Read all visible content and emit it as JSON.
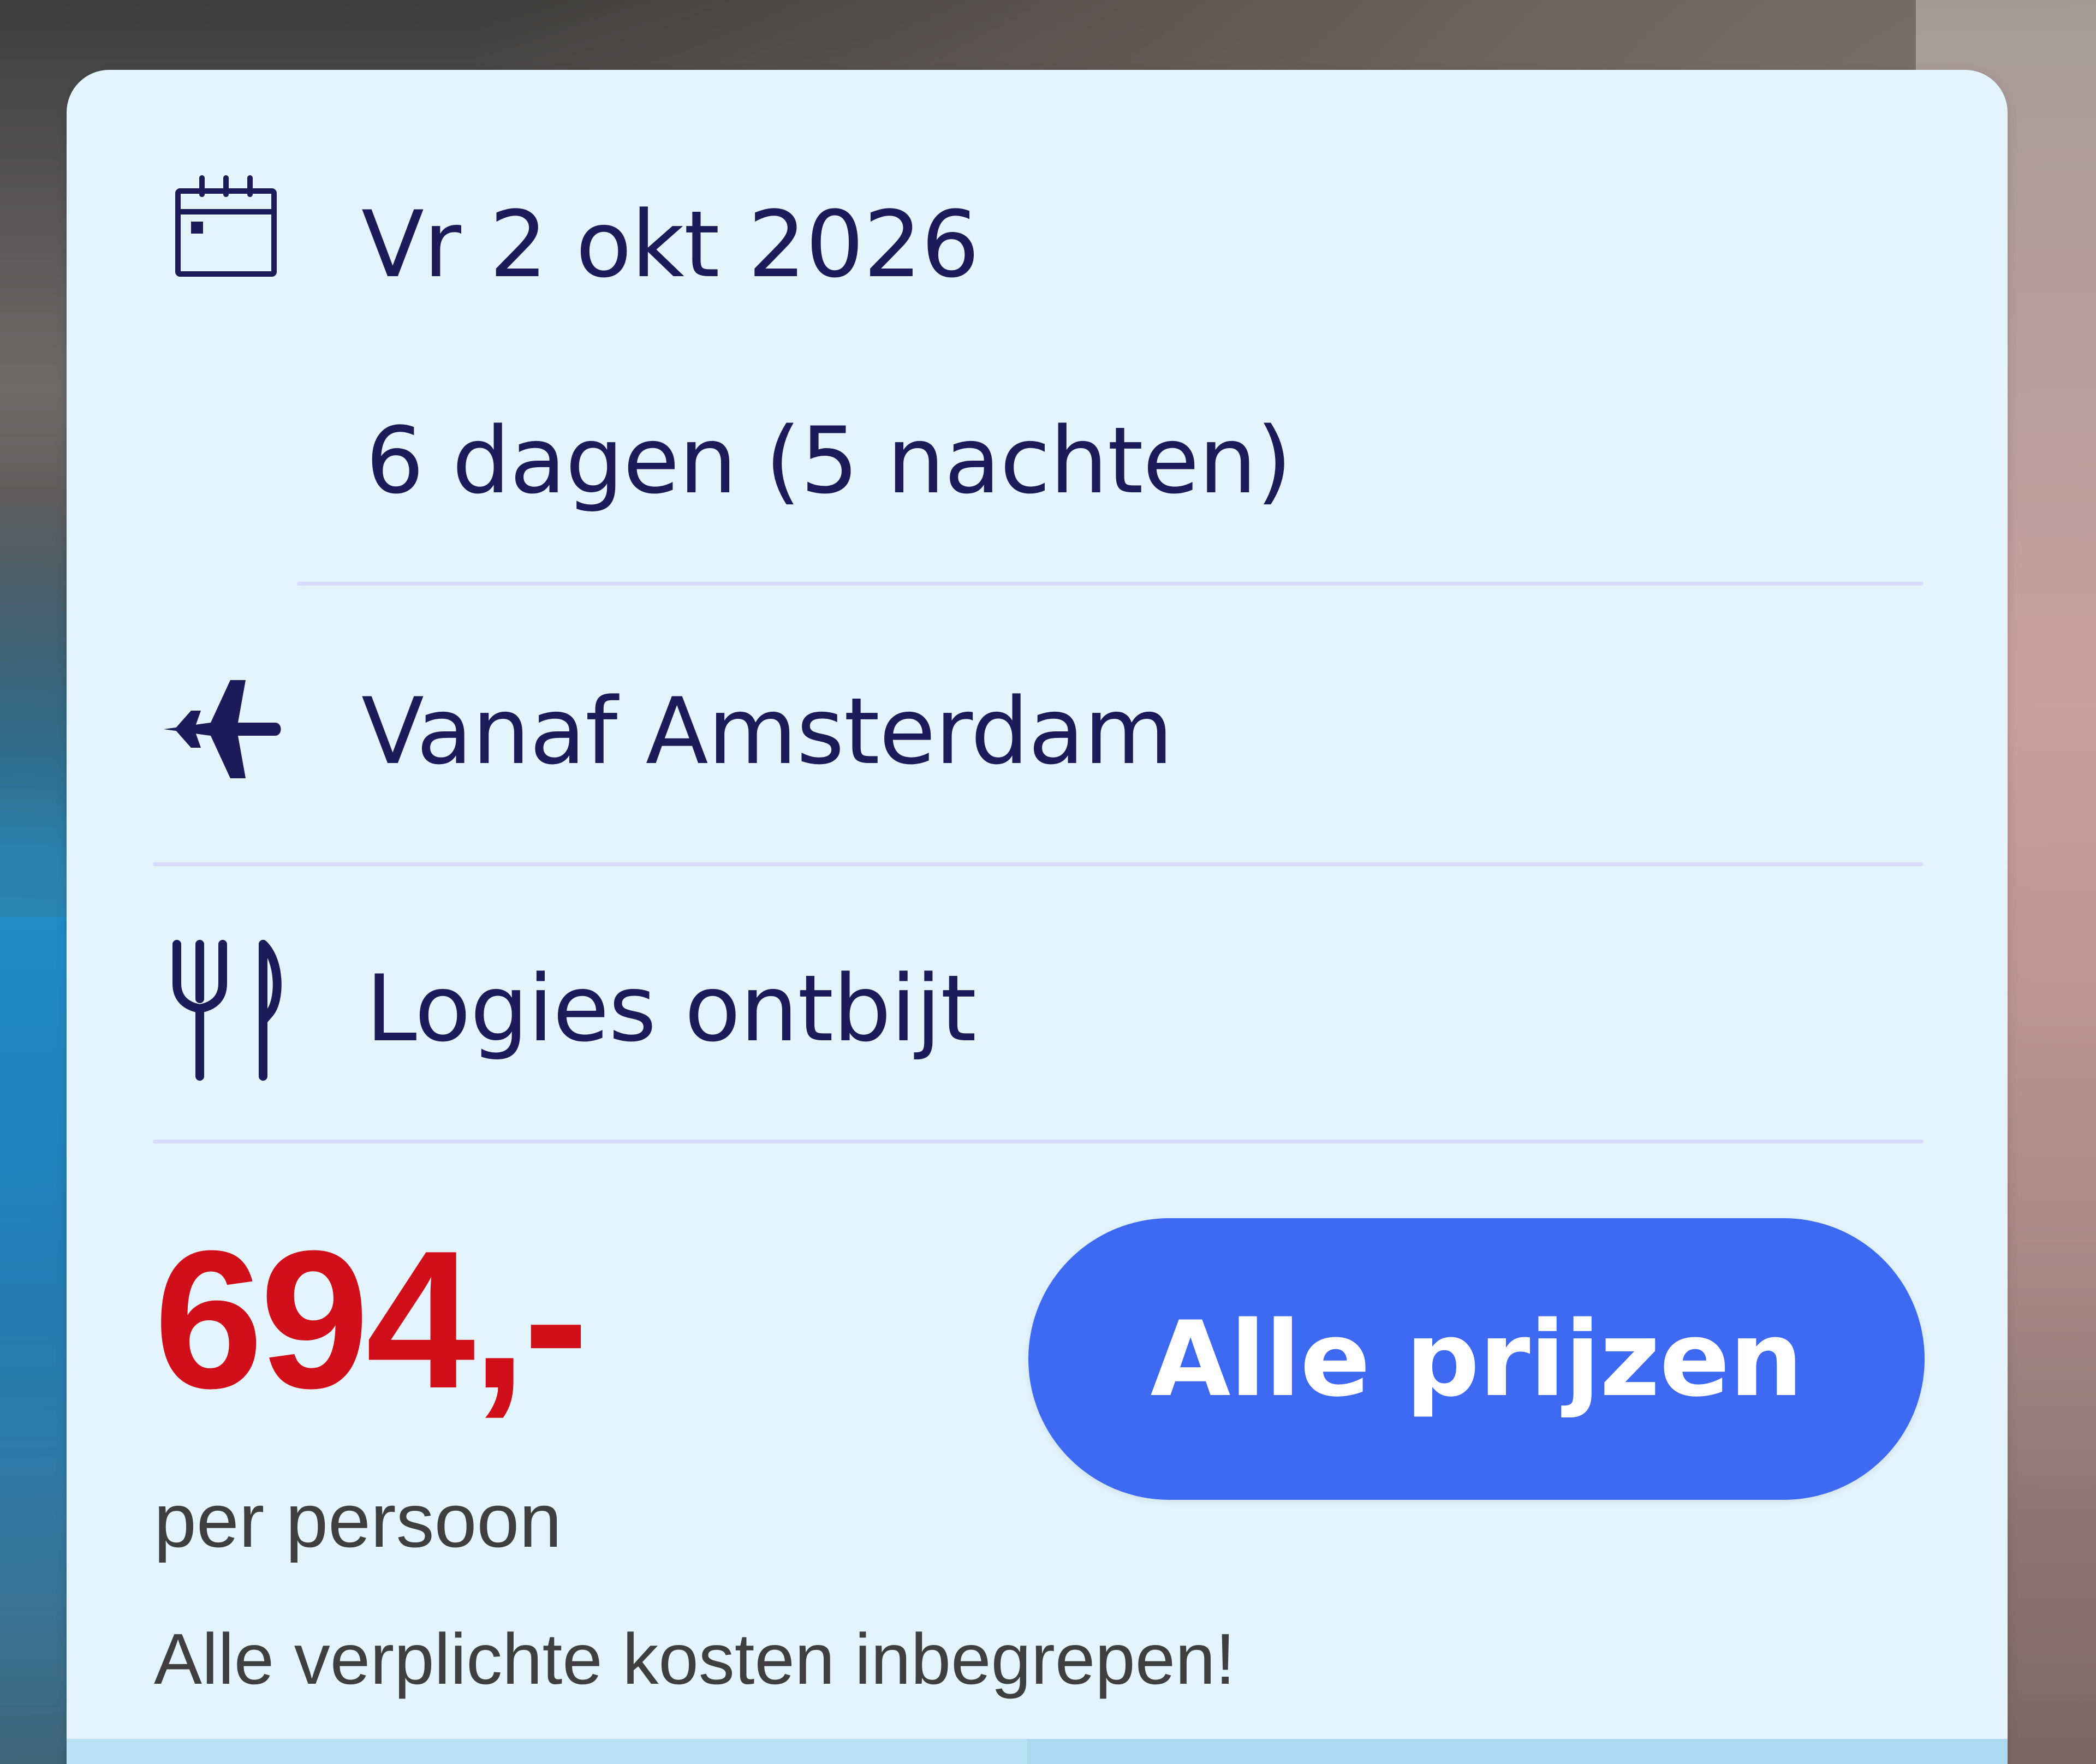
{
  "card": {
    "date": "Vr 2 okt 2026",
    "duration": "6 dagen (5 nachten)",
    "departure": "Vanaf Amsterdam",
    "board": "Logies ontbijt",
    "price": "694,-",
    "price_unit": "per persoon",
    "price_note": "Alle verplichte kosten inbegrepen!",
    "cta_label": "Alle prijzen"
  },
  "colors": {
    "card_background": "#e3f4fc",
    "text_primary": "#1d1b5a",
    "divider": "#d7dcff",
    "price_red": "#d10f1a",
    "cta_blue": "#3e69f3",
    "muted_text": "#3f3f3f"
  },
  "icons": {
    "date": "calendar-icon",
    "departure": "airplane-icon",
    "board": "fork-knife-icon"
  }
}
